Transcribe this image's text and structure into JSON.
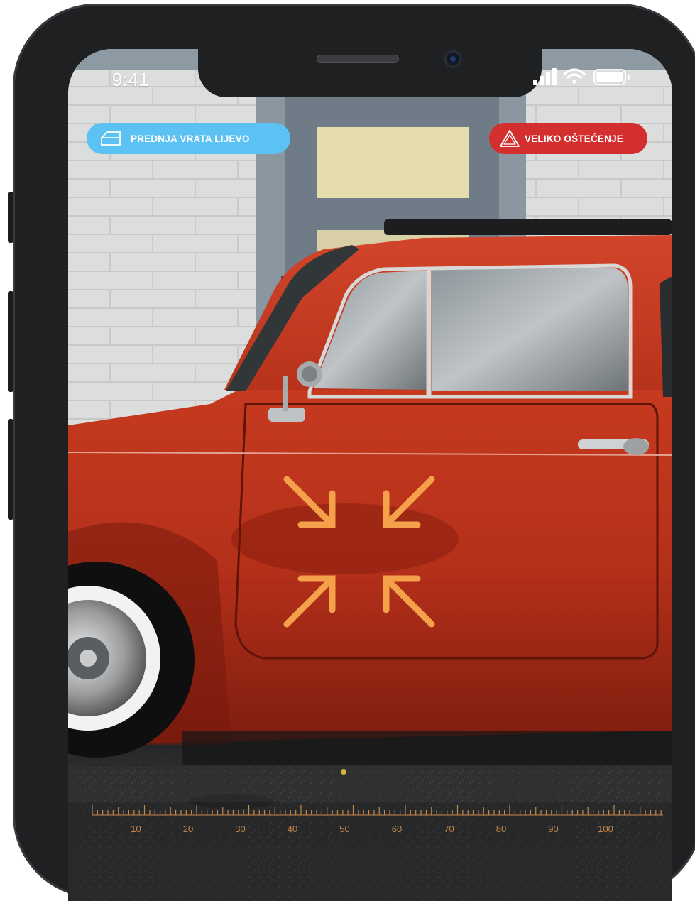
{
  "status_bar": {
    "time": "9:41",
    "icons": [
      "cellular-signal-icon",
      "wifi-icon",
      "battery-icon"
    ]
  },
  "part_badge": {
    "label": "PREDNJA VRATA LIJEVO",
    "icon": "car-door-icon",
    "color": "#5cc1f3"
  },
  "damage_badge": {
    "label": "VELIKO OŠTEĆENJE",
    "icon": "warning-triangle-icon",
    "color": "#d32f2f"
  },
  "focus_indicator": {
    "icon": "focus-arrows-inward-icon",
    "color": "#f5a04a"
  },
  "ruler": {
    "labels": [
      "10",
      "20",
      "30",
      "40",
      "50",
      "60",
      "70",
      "80",
      "90",
      "100"
    ],
    "color": "#c8874a"
  }
}
